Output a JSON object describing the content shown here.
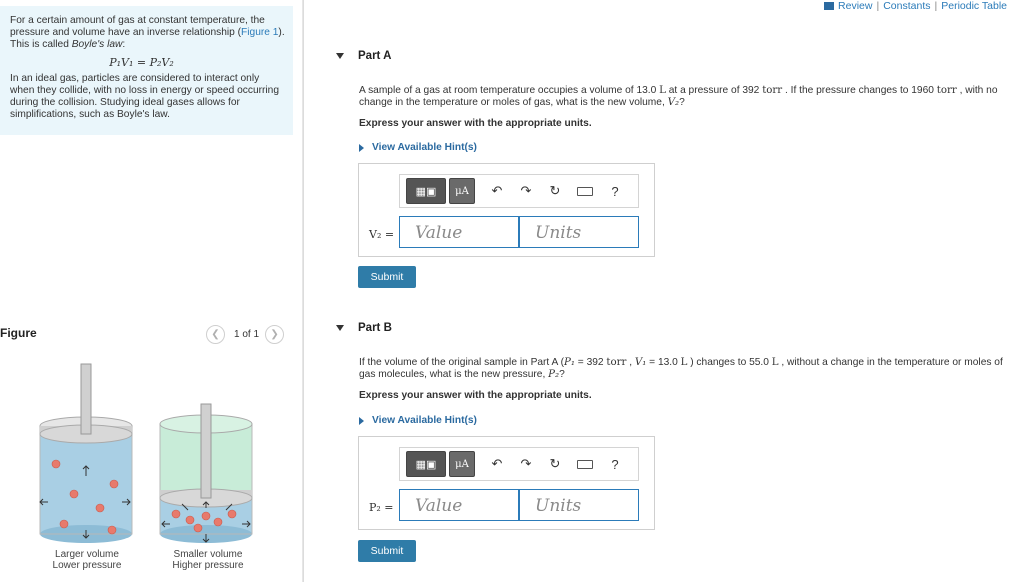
{
  "intro": {
    "text1": "For a certain amount of gas at constant temperature, the pressure and volume have an inverse relationship (",
    "figure_link": "Figure 1",
    "text2": "). This is called ",
    "law_name": "Boyle's law",
    "text3": ":",
    "equation": "P₁V₁ = P₂V₂",
    "paragraph": "In an ideal gas, particles are considered to interact only when they collide, with no loss in energy or speed occurring during the collision. Studying ideal gases allows for simplifications, such as Boyle's law."
  },
  "figure": {
    "title": "Figure",
    "pager": "1 of 1",
    "prev_icon": "chevron-left-icon",
    "next_icon": "chevron-right-icon",
    "left_caption_1": "Larger volume",
    "left_caption_2": "Lower pressure",
    "right_caption_1": "Smaller volume",
    "right_caption_2": "Higher pressure"
  },
  "top_links": {
    "review": "Review",
    "sep1": "|",
    "constants": "Constants",
    "sep2": "|",
    "periodic": "Periodic Table"
  },
  "part_a": {
    "title": "Part A",
    "q1": "A sample of a gas at room temperature occupies a volume of 13.0 ",
    "u_L": "L",
    "q2": " at a pressure of 392 ",
    "u_torr": "torr",
    "q3": " . If the pressure changes to 1960 ",
    "u_torr2": "torr",
    "q4": " , with no change in the temperature or moles of gas, what is the new volume, ",
    "var": "V₂",
    "q5": "?",
    "express": "Express your answer with the appropriate units.",
    "hint": "View Available Hint(s)",
    "var_label": "V₂ =",
    "value_placeholder": "Value",
    "units_placeholder": "Units",
    "submit": "Submit"
  },
  "part_b": {
    "title": "Part B",
    "q1": "If the volume of the original sample in Part A (",
    "p1": "P₁",
    "q2": " = 392 ",
    "u_torr": "torr",
    "q3": " , ",
    "v1": "V₁",
    "q4": " = 13.0 ",
    "u_L": "L",
    "q5": " ) changes to 55.0 ",
    "u_L2": "L",
    "q6": " , without a change in the temperature or moles of gas molecules, what is the new pressure, ",
    "var": "P₂",
    "q7": "?",
    "express": "Express your answer with the appropriate units.",
    "hint": "View Available Hint(s)",
    "var_label": "P₂ =",
    "value_placeholder": "Value",
    "units_placeholder": "Units",
    "submit": "Submit"
  },
  "toolbar": {
    "templates_icon": "templates-icon",
    "units_icon": "mu-a-units-icon",
    "units_label": "μA",
    "undo": "↶",
    "redo": "↷",
    "reset": "↻",
    "keyboard_icon": "keyboard-icon",
    "help": "?"
  },
  "colors": {
    "intro_bg": "#eaf6fb",
    "link": "#2b7bb9",
    "submit_bg": "#2f7ca8"
  }
}
